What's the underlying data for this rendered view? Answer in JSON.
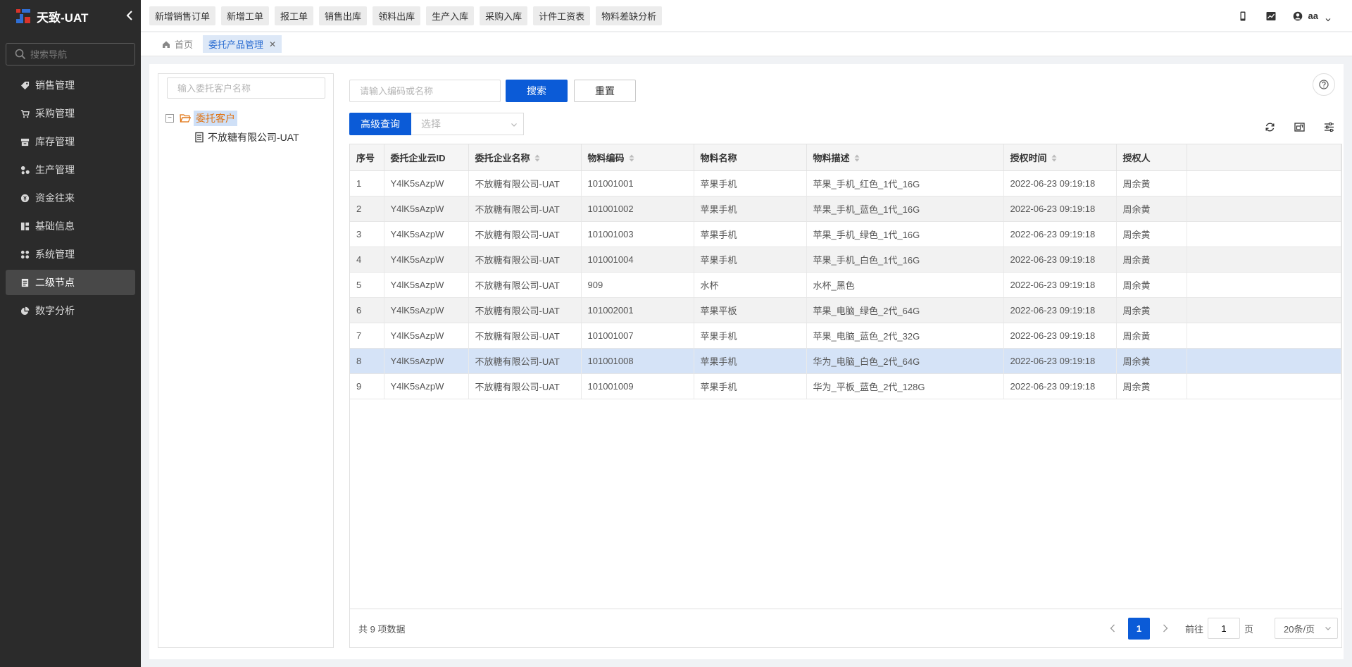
{
  "app": {
    "title": "天致-UAT",
    "collapse_icon": "chevron-left-icon"
  },
  "sidebar": {
    "search_placeholder": "搜索导航",
    "items": [
      {
        "label": "销售管理",
        "icon": "tag-icon"
      },
      {
        "label": "采购管理",
        "icon": "cart-icon"
      },
      {
        "label": "库存管理",
        "icon": "warehouse-icon"
      },
      {
        "label": "生产管理",
        "icon": "production-icon"
      },
      {
        "label": "资金往来",
        "icon": "money-icon"
      },
      {
        "label": "基础信息",
        "icon": "grid-icon"
      },
      {
        "label": "系统管理",
        "icon": "settings-icon"
      },
      {
        "label": "二级节点",
        "icon": "document-icon",
        "active": true
      },
      {
        "label": "数字分析",
        "icon": "pie-chart-icon"
      }
    ]
  },
  "toolbar": {
    "quick_buttons": [
      "新增销售订单",
      "新增工单",
      "报工单",
      "销售出库",
      "领料出库",
      "生产入库",
      "采购入库",
      "计件工资表",
      "物料差缺分析"
    ],
    "user_name": "aa"
  },
  "tabs": [
    {
      "label": "首页",
      "icon": "home-icon",
      "active": false
    },
    {
      "label": "委托产品管理",
      "active": true,
      "closable": true
    }
  ],
  "tree": {
    "search_placeholder": "输入委托客户名称",
    "root": {
      "toggle": "−",
      "label": "委托客户"
    },
    "child": {
      "label": "不放糖有限公司-UAT"
    }
  },
  "filters": {
    "code_placeholder": "请输入编码或名称",
    "search_label": "搜索",
    "reset_label": "重置",
    "advanced_label": "高级查询",
    "select_placeholder": "选择"
  },
  "table": {
    "headers": [
      "序号",
      "委托企业云ID",
      "委托企业名称",
      "物料编码",
      "物料名称",
      "物料描述",
      "授权时间",
      "授权人"
    ],
    "sortable": [
      false,
      false,
      true,
      true,
      false,
      true,
      true,
      false
    ],
    "rows": [
      [
        "1",
        "Y4lK5sAzpW",
        "不放糖有限公司-UAT",
        "101001001",
        "苹果手机",
        "苹果_手机_红色_1代_16G",
        "2022-06-23 09:19:18",
        "周余黄"
      ],
      [
        "2",
        "Y4lK5sAzpW",
        "不放糖有限公司-UAT",
        "101001002",
        "苹果手机",
        "苹果_手机_蓝色_1代_16G",
        "2022-06-23 09:19:18",
        "周余黄"
      ],
      [
        "3",
        "Y4lK5sAzpW",
        "不放糖有限公司-UAT",
        "101001003",
        "苹果手机",
        "苹果_手机_绿色_1代_16G",
        "2022-06-23 09:19:18",
        "周余黄"
      ],
      [
        "4",
        "Y4lK5sAzpW",
        "不放糖有限公司-UAT",
        "101001004",
        "苹果手机",
        "苹果_手机_白色_1代_16G",
        "2022-06-23 09:19:18",
        "周余黄"
      ],
      [
        "5",
        "Y4lK5sAzpW",
        "不放糖有限公司-UAT",
        "909",
        "水杯",
        "水杯_黑色",
        "2022-06-23 09:19:18",
        "周余黄"
      ],
      [
        "6",
        "Y4lK5sAzpW",
        "不放糖有限公司-UAT",
        "101002001",
        "苹果平板",
        "苹果_电脑_绿色_2代_64G",
        "2022-06-23 09:19:18",
        "周余黄"
      ],
      [
        "7",
        "Y4lK5sAzpW",
        "不放糖有限公司-UAT",
        "101001007",
        "苹果手机",
        "苹果_电脑_蓝色_2代_32G",
        "2022-06-23 09:19:18",
        "周余黄"
      ],
      [
        "8",
        "Y4lK5sAzpW",
        "不放糖有限公司-UAT",
        "101001008",
        "苹果手机",
        "华为_电脑_白色_2代_64G",
        "2022-06-23 09:19:18",
        "周余黄"
      ],
      [
        "9",
        "Y4lK5sAzpW",
        "不放糖有限公司-UAT",
        "101001009",
        "苹果手机",
        "华为_平板_蓝色_2代_128G",
        "2022-06-23 09:19:18",
        "周余黄"
      ]
    ],
    "selected_row": 8
  },
  "pagination": {
    "total_text": "共 9 项数据",
    "current_page": "1",
    "goto_label": "前往",
    "goto_value": "1",
    "page_suffix": "页",
    "page_size": "20条/页"
  },
  "colors": {
    "sidebar_bg": "#2b2b2b",
    "primary": "#0b5bd7",
    "selected_row": "#d5e3f7",
    "active_tab": "#dde8f7"
  }
}
